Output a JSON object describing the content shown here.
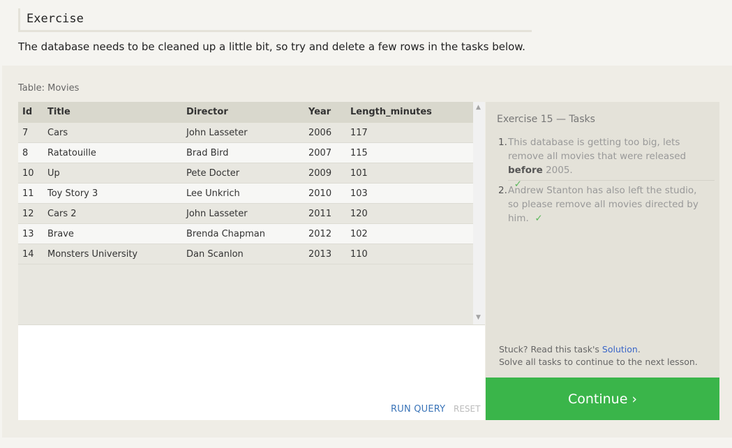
{
  "header": {
    "title": "Exercise"
  },
  "intro": "The database needs to be cleaned up a little bit, so try and delete a few rows in the tasks below.",
  "table": {
    "label": "Table: Movies",
    "columns": [
      "Id",
      "Title",
      "Director",
      "Year",
      "Length_minutes"
    ],
    "rows": [
      [
        "7",
        "Cars",
        "John Lasseter",
        "2006",
        "117"
      ],
      [
        "8",
        "Ratatouille",
        "Brad Bird",
        "2007",
        "115"
      ],
      [
        "10",
        "Up",
        "Pete Docter",
        "2009",
        "101"
      ],
      [
        "11",
        "Toy Story 3",
        "Lee Unkrich",
        "2010",
        "103"
      ],
      [
        "12",
        "Cars 2",
        "John Lasseter",
        "2011",
        "120"
      ],
      [
        "13",
        "Brave",
        "Brenda Chapman",
        "2012",
        "102"
      ],
      [
        "14",
        "Monsters University",
        "Dan Scanlon",
        "2013",
        "110"
      ]
    ]
  },
  "scrollbar": {
    "up_arrow": "▲",
    "down_arrow": "▼"
  },
  "editor": {
    "run_label": "RUN QUERY",
    "reset_label": "RESET"
  },
  "tasks": {
    "title": "Exercise 15 — Tasks",
    "items": [
      {
        "num": "1.",
        "text_before": "This database is getting too big, lets remove all movies that were released ",
        "bold": "before",
        "text_after": " 2005.",
        "check": "✓"
      },
      {
        "num": "2.",
        "text_before": "Andrew Stanton has also left the studio, so please remove all movies directed by him.",
        "bold": "",
        "text_after": "",
        "check": "✓"
      }
    ]
  },
  "help": {
    "stuck_prefix": "Stuck? Read this task's ",
    "solution_link": "Solution",
    "stuck_suffix": ".",
    "line2": "Solve all tasks to continue to the next lesson."
  },
  "continue_label": "Continue ›"
}
